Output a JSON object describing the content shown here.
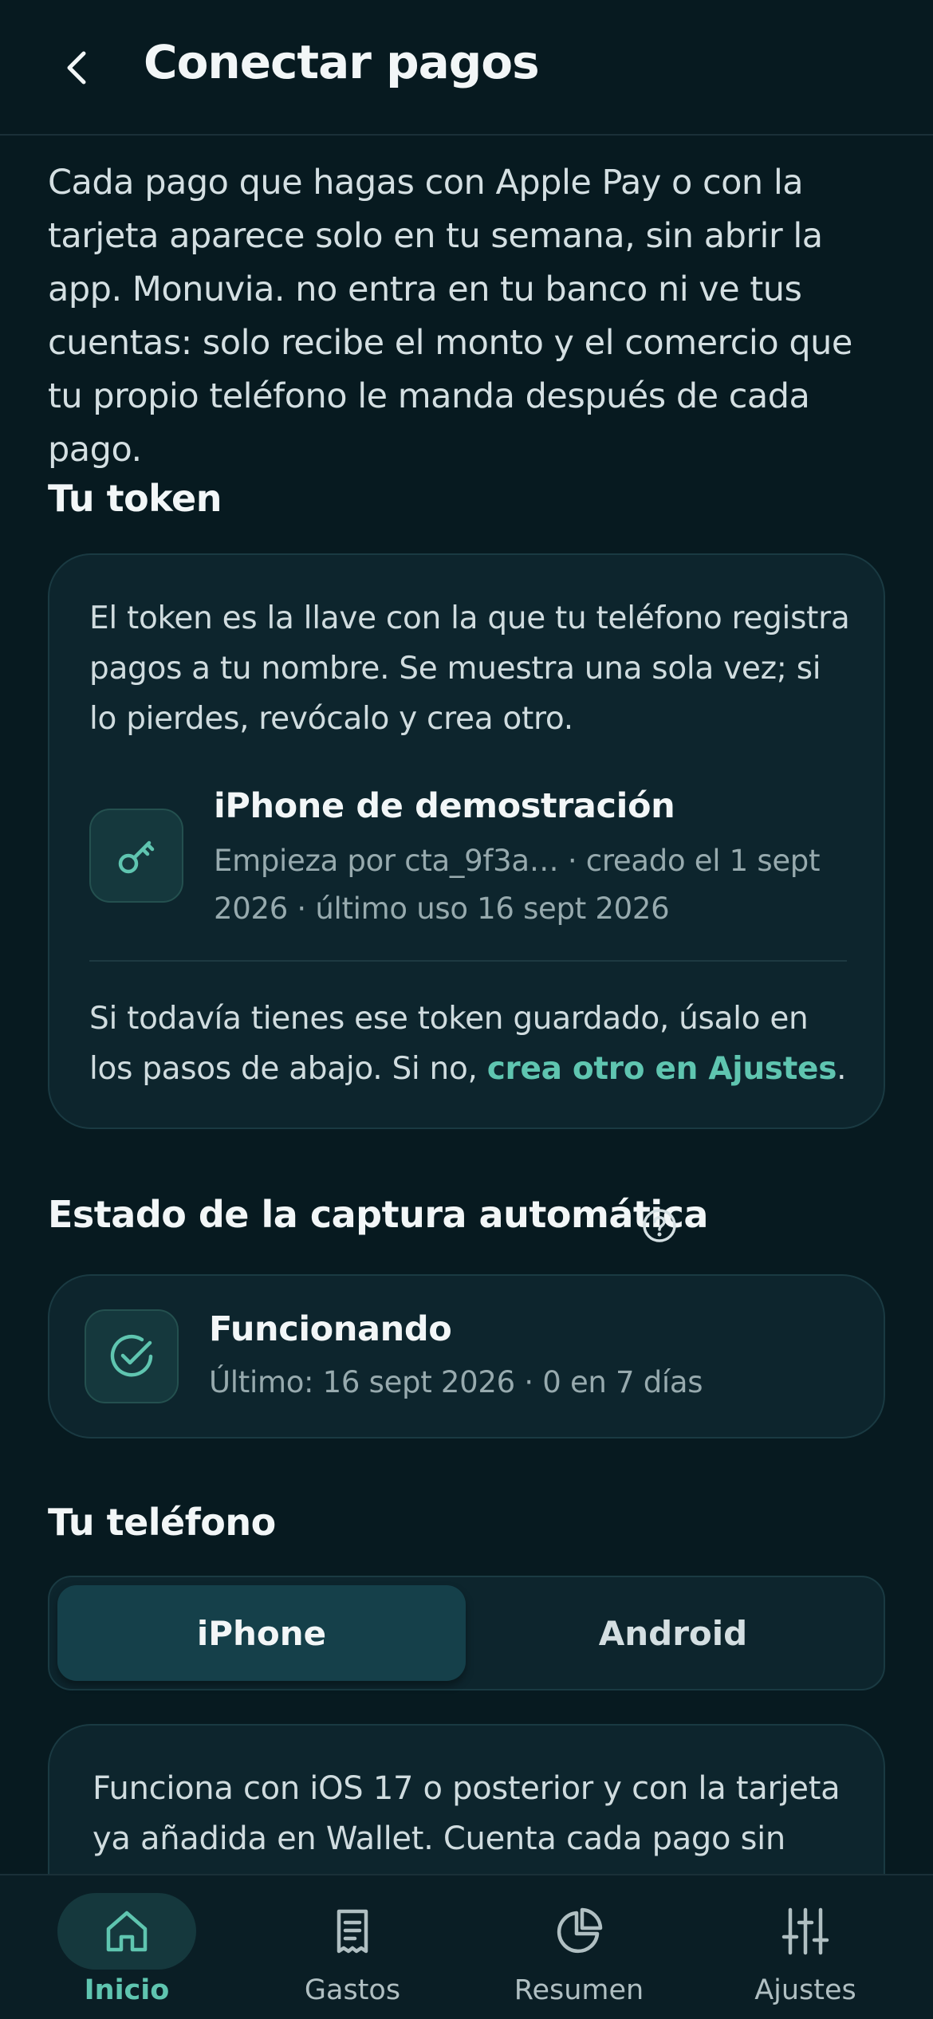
{
  "header": {
    "title": "Conectar pagos"
  },
  "intro": "Cada pago que hagas con Apple Pay o con la tarjeta aparece solo en tu semana, sin abrir la app. Monuvia. no entra en tu banco ni ve tus cuentas: solo recibe el monto y el comercio que tu propio teléfono le manda después de cada pago.",
  "token_section": {
    "title": "Tu token",
    "description": "El token es la llave con la que tu teléfono registra pagos a tu nombre. Se muestra una sola vez; si lo pierdes, revócalo y crea otro.",
    "device_name": "iPhone de demostración",
    "device_meta": "Empieza por cta_9f3a… · creado el 1 sept 2026 · último uso 16 sept 2026",
    "note_prefix": "Si todavía tienes ese token guardado, úsalo en los pasos de abajo. Si no, ",
    "note_link": "crea otro en Ajustes",
    "note_suffix": "."
  },
  "capture_section": {
    "title": "Estado de la captura automática",
    "status": "Funcionando",
    "detail": "Último: 16 sept 2026 · 0 en 7 días"
  },
  "phone_section": {
    "title": "Tu teléfono",
    "options": [
      "iPhone",
      "Android"
    ],
    "selected": "iPhone",
    "instructions": "Funciona con iOS 17 o posterior y con la tarjeta ya añadida en Wallet. Cuenta cada pago sin"
  },
  "nav": {
    "items": [
      {
        "label": "Inicio",
        "icon": "home-icon",
        "active": true
      },
      {
        "label": "Gastos",
        "icon": "receipt-icon",
        "active": false
      },
      {
        "label": "Resumen",
        "icon": "pie-chart-icon",
        "active": false
      },
      {
        "label": "Ajustes",
        "icon": "sliders-icon",
        "active": false
      }
    ]
  },
  "colors": {
    "background": "#071a20",
    "card": "#0d252d",
    "accent": "#5fc5b0"
  }
}
